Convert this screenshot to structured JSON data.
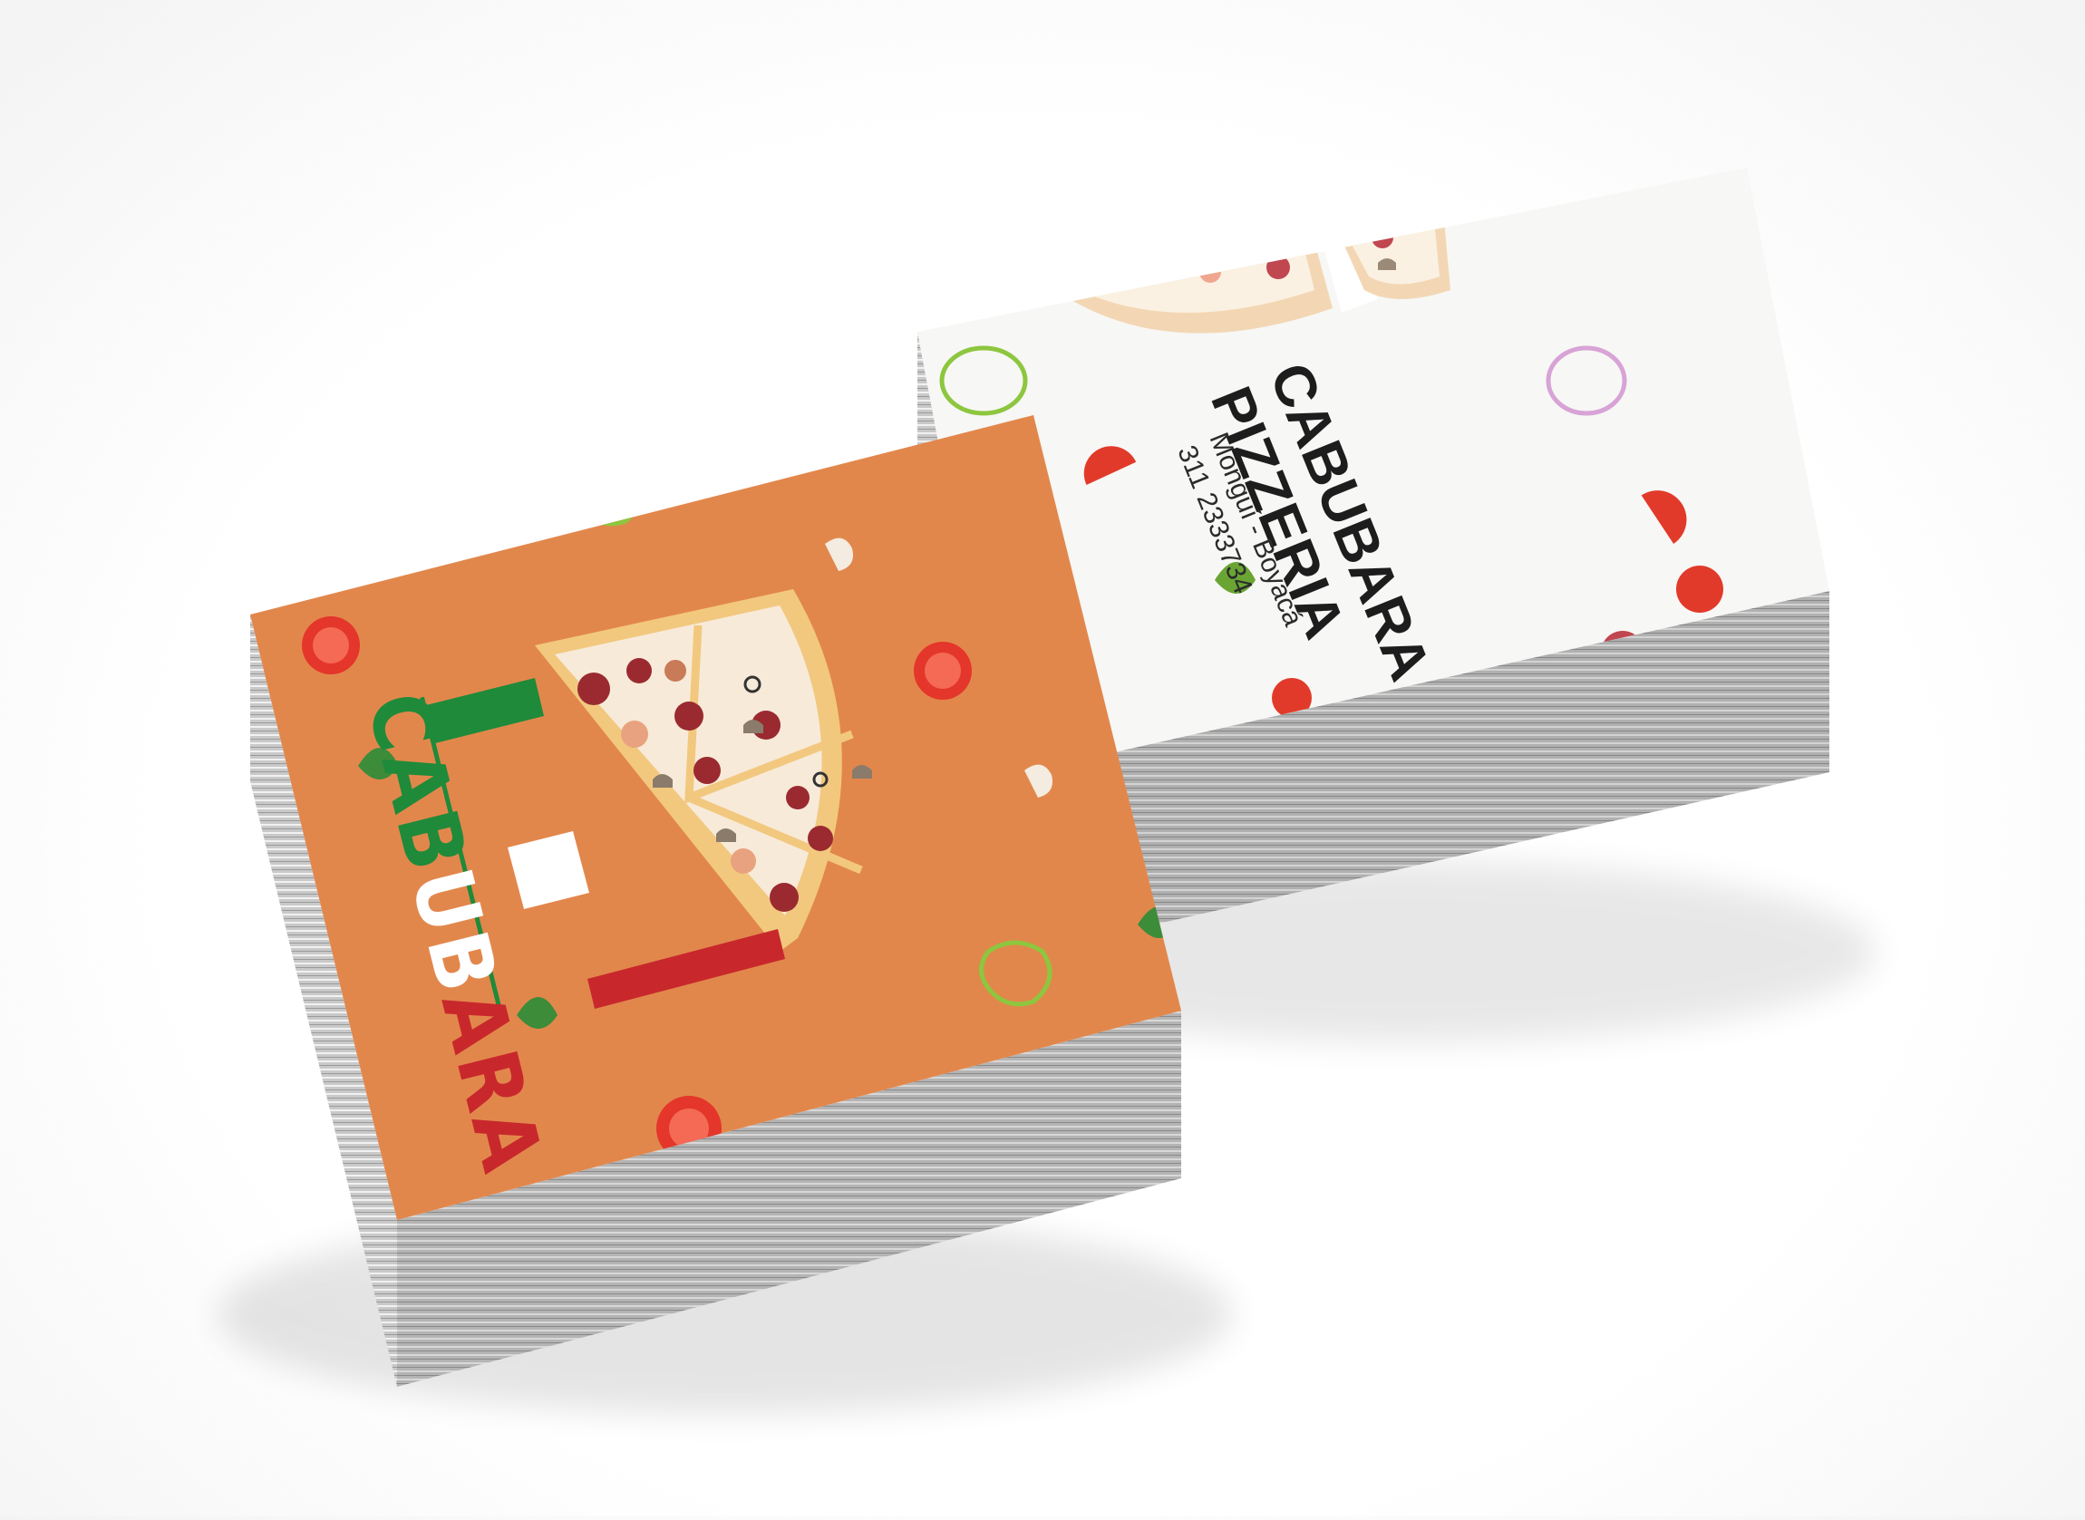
{
  "front_card": {
    "brand_letters": [
      "C",
      "A",
      "B",
      "U",
      "B",
      "A",
      "R",
      "A"
    ],
    "background_color": "#e2874c",
    "flag_colors": {
      "green": "#1f8a3a",
      "white": "#ffffff",
      "red": "#c8282c"
    }
  },
  "back_card": {
    "title_line1": "CABUBARA",
    "title_line2": "PIZZERIA",
    "location": "Monguí - Boyacá",
    "phone": "311 2333734",
    "background_color": "#f7f7f5"
  }
}
